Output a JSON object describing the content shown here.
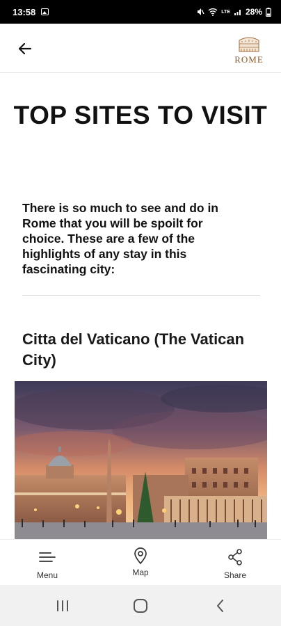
{
  "status_bar": {
    "time": "13:58",
    "battery": "28%",
    "network": "LTE"
  },
  "app_bar": {
    "logo_text": "ROME",
    "back_icon": "arrow-left-icon"
  },
  "content": {
    "title": "TOP SITES TO VISIT",
    "intro": "There is so much to see and do in Rome that you will be spoilt for choice. These are a few of the highlights of any stay in this fascinating city:",
    "section_title": "Citta del Vaticano (The Vatican City)"
  },
  "bottom_nav": {
    "items": [
      {
        "label": "Menu",
        "icon": "menu-icon"
      },
      {
        "label": "Map",
        "icon": "map-pin-icon"
      },
      {
        "label": "Share",
        "icon": "share-icon"
      }
    ]
  },
  "system_nav": {
    "icons": [
      "recents-icon",
      "home-icon",
      "back-icon"
    ]
  }
}
